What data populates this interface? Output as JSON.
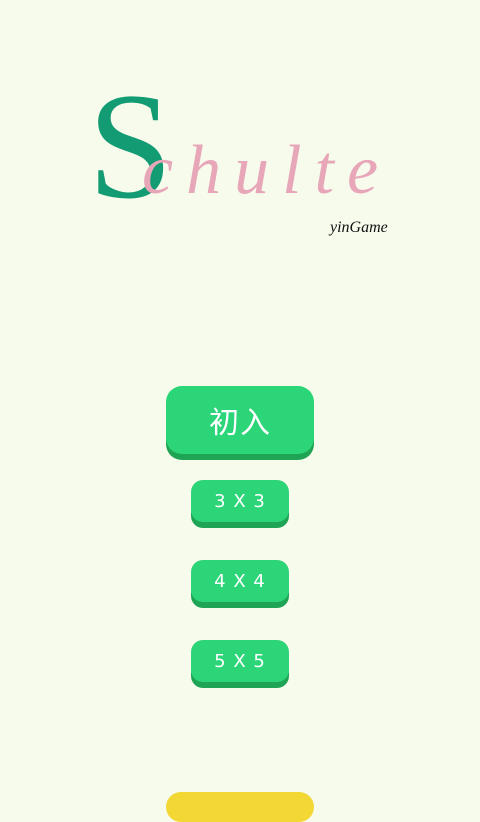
{
  "header": {
    "logo_initial": "S",
    "logo_rest": "chulte",
    "subtitle": "yinGame"
  },
  "menu": {
    "start_label": "初入",
    "modes": [
      {
        "label": "3 X 3"
      },
      {
        "label": "4 X 4"
      },
      {
        "label": "5 X 5"
      }
    ]
  },
  "colors": {
    "background": "#f7fbec",
    "logo_initial": "#139b73",
    "logo_rest": "#e7a7b9",
    "button": "#2bd578",
    "button_shadow": "#1ea454",
    "bottom_button": "#f3d735"
  }
}
